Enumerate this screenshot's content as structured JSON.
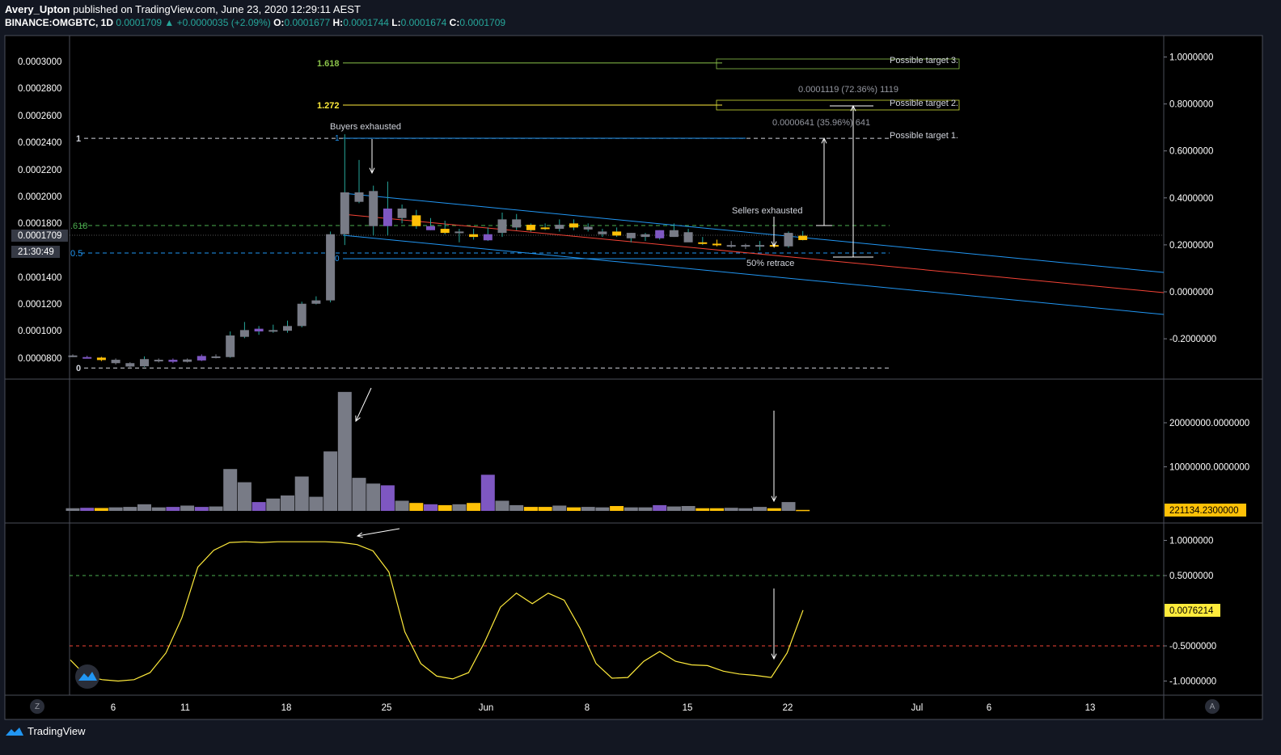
{
  "header": {
    "publisher": "Avery_Upton",
    "published_text": "published on TradingView.com, June 23, 2020 12:29:11 AEST",
    "symbol": "BINANCE:OMGBTC, 1D",
    "last": "0.0001709",
    "change_arrow": "▲",
    "change": "+0.0000035 (+2.09%)",
    "o_label": "O:",
    "o": "0.0001677",
    "h_label": "H:",
    "h": "0.0001744",
    "l_label": "L:",
    "l": "0.0001674",
    "c_label": "C:",
    "c": "0.0001709"
  },
  "price_axis_left": [
    "0.0003000",
    "0.0002800",
    "0.0002600",
    "0.0002400",
    "0.0002200",
    "0.0002000",
    "0.0001800",
    "0.0001709",
    "0.0001400",
    "0.0001200",
    "0.0001000",
    "0.0000800"
  ],
  "countdown": "21:30:49",
  "right_axis_main": [
    "1.0000000",
    "0.8000000",
    "0.6000000",
    "0.4000000",
    "0.2000000",
    "0.0000000",
    "-0.2000000"
  ],
  "right_axis_volume": [
    "20000000.0000000",
    "10000000.0000000"
  ],
  "volume_tag": "221134.2300000",
  "right_axis_osc": [
    "1.0000000",
    "0.5000000",
    "-0.5000000",
    "-1.0000000"
  ],
  "osc_tag": "0.0076214",
  "time_axis": [
    "6",
    "11",
    "18",
    "25",
    "Jun",
    "8",
    "15",
    "22",
    "Jul",
    "6",
    "13"
  ],
  "fib_labels": {
    "f1618": "1.618",
    "f1272": "1.272",
    "f1": "1",
    "f0": "0",
    "f618": ".618",
    "f05": "0.5",
    "inner1": "1",
    "inner0": "0"
  },
  "annotations": {
    "buyers": "Buyers exhausted",
    "sellers": "Sellers exhausted",
    "retrace": "50% retrace",
    "target3": "Possible target 3.",
    "target2": "Possible target 2.",
    "target1": "Possible target 1.",
    "measure1": "0.0001119 (72.36%) 1119",
    "measure2": "0.0000641 (35.96%) 641"
  },
  "corner_buttons": {
    "left": "Z",
    "right": "A"
  },
  "footer": {
    "brand": "TradingView"
  },
  "colors": {
    "background": "#131722",
    "up_candle": "#787b86",
    "down_candle": "#ffc107",
    "purple_candle": "#7e57c2",
    "channel": "#2196f3",
    "midline": "#f44336",
    "oscillator": "#ffeb3b",
    "fib_1618": "#8bc34a",
    "fib_1272": "#ffeb3b"
  },
  "chart_data": {
    "type": "candlestick",
    "symbol": "BINANCE:OMGBTC",
    "interval": "1D",
    "candles": [
      {
        "o": 8.22e-05,
        "h": 8.3e-05,
        "l": 8.1e-05,
        "c": 8.18e-05
      },
      {
        "o": 8.1e-05,
        "h": 8.2e-05,
        "l": 8e-05,
        "c": 8.05e-05
      },
      {
        "o": 8.06e-05,
        "h": 8.12e-05,
        "l": 7.8e-05,
        "c": 7.88e-05
      },
      {
        "o": 7.9e-05,
        "h": 8e-05,
        "l": 7.55e-05,
        "c": 7.65e-05
      },
      {
        "o": 7.65e-05,
        "h": 7.72e-05,
        "l": 7.35e-05,
        "c": 7.4e-05
      },
      {
        "o": 7.42e-05,
        "h": 8.15e-05,
        "l": 7.38e-05,
        "c": 7.95e-05
      },
      {
        "o": 7.85e-05,
        "h": 8e-05,
        "l": 7.7e-05,
        "c": 7.9e-05
      },
      {
        "o": 7.9e-05,
        "h": 8e-05,
        "l": 7.65e-05,
        "c": 7.75e-05
      },
      {
        "o": 7.75e-05,
        "h": 8e-05,
        "l": 7.7e-05,
        "c": 7.92e-05
      },
      {
        "o": 7.85e-05,
        "h": 8.3e-05,
        "l": 7.8e-05,
        "c": 8.18e-05
      },
      {
        "o": 8.08e-05,
        "h": 8.3e-05,
        "l": 8e-05,
        "c": 8.15e-05
      },
      {
        "o": 8.1e-05,
        "h": 0.0001,
        "l": 8.05e-05,
        "c": 9.7e-05
      },
      {
        "o": 9.6e-05,
        "h": 0.000107,
        "l": 9.5e-05,
        "c": 0.000101
      },
      {
        "o": 0.0001,
        "h": 0.000104,
        "l": 9.75e-05,
        "c": 0.000102
      },
      {
        "o": 0.000101,
        "h": 0.000105,
        "l": 9.9e-05,
        "c": 0.0001
      },
      {
        "o": 0.0001005,
        "h": 0.000108,
        "l": 9.9e-05,
        "c": 0.000104
      },
      {
        "o": 0.000104,
        "h": 0.000122,
        "l": 0.000103,
        "c": 0.0001205
      },
      {
        "o": 0.0001205,
        "h": 0.000126,
        "l": 0.00012,
        "c": 0.000123
      },
      {
        "o": 0.000123,
        "h": 0.000174,
        "l": 0.0001215,
        "c": 0.000172
      },
      {
        "o": 0.000172,
        "h": 0.000246,
        "l": 0.000164,
        "c": 0.000203
      },
      {
        "o": 0.000203,
        "h": 0.000227,
        "l": 0.000195,
        "c": 0.000196
      },
      {
        "o": 0.000204,
        "h": 0.000208,
        "l": 0.000171,
        "c": 0.000178
      },
      {
        "o": 0.000178,
        "h": 0.000211,
        "l": 0.000171,
        "c": 0.000191
      },
      {
        "o": 0.000191,
        "h": 0.000194,
        "l": 0.00018,
        "c": 0.000184
      },
      {
        "o": 0.000186,
        "h": 0.00019,
        "l": 0.000176,
        "c": 0.000178
      },
      {
        "o": 0.000178,
        "h": 0.000184,
        "l": 0.000175,
        "c": 0.000175
      },
      {
        "o": 0.000176,
        "h": 0.000182,
        "l": 0.000172,
        "c": 0.000173
      },
      {
        "o": 0.000173,
        "h": 0.000176,
        "l": 0.000166,
        "c": 0.000174
      },
      {
        "o": 0.000172,
        "h": 0.000176,
        "l": 0.000168,
        "c": 0.00017
      },
      {
        "o": 0.000172,
        "h": 0.000177,
        "l": 0.000167,
        "c": 0.0001675
      },
      {
        "o": 0.000173,
        "h": 0.000188,
        "l": 0.00017,
        "c": 0.000183
      },
      {
        "o": 0.000177,
        "h": 0.000187,
        "l": 0.000175,
        "c": 0.000183
      },
      {
        "o": 0.000179,
        "h": 0.00018,
        "l": 0.000174,
        "c": 0.000175
      },
      {
        "o": 0.000177,
        "h": 0.00018,
        "l": 0.000175,
        "c": 0.000176
      },
      {
        "o": 0.000176,
        "h": 0.000183,
        "l": 0.000174,
        "c": 0.000179
      },
      {
        "o": 0.000177,
        "h": 0.000183,
        "l": 0.000175,
        "c": 0.00018
      },
      {
        "o": 0.0001775,
        "h": 0.00018,
        "l": 0.000174,
        "c": 0.0001755
      },
      {
        "o": 0.000174,
        "h": 0.000176,
        "l": 0.00017,
        "c": 0.000172
      },
      {
        "o": 0.000174,
        "h": 0.000177,
        "l": 0.00017,
        "c": 0.000171
      },
      {
        "o": 0.000169,
        "h": 0.000173,
        "l": 0.000166,
        "c": 0.000173
      },
      {
        "o": 0.000172,
        "h": 0.000173,
        "l": 0.000167,
        "c": 0.00017
      },
      {
        "o": 0.000169,
        "h": 0.000175,
        "l": 0.000168,
        "c": 0.000175
      },
      {
        "o": 0.000175,
        "h": 0.00018,
        "l": 0.00017,
        "c": 0.00017
      },
      {
        "o": 0.0001735,
        "h": 0.000176,
        "l": 0.000168,
        "c": 0.000166
      },
      {
        "o": 0.000166,
        "h": 0.00017,
        "l": 0.000164,
        "c": 0.000165
      },
      {
        "o": 0.000165,
        "h": 0.000168,
        "l": 0.000163,
        "c": 0.000164
      },
      {
        "o": 0.000164,
        "h": 0.000167,
        "l": 0.000162,
        "c": 0.000163
      },
      {
        "o": 0.000163,
        "h": 0.000165,
        "l": 0.000161,
        "c": 0.000164
      },
      {
        "o": 0.000164,
        "h": 0.000167,
        "l": 0.00016,
        "c": 0.000164
      },
      {
        "o": 0.000163,
        "h": 0.000165,
        "l": 0.000162,
        "c": 0.000164
      },
      {
        "o": 0.000163,
        "h": 0.000174,
        "l": 0.000162,
        "c": 0.000173
      },
      {
        "o": 0.0001677,
        "h": 0.0001744,
        "l": 0.0001674,
        "c": 0.0001709
      }
    ],
    "candle_colors": [
      "gray",
      "purple",
      "gold",
      "gray",
      "gray",
      "gray",
      "gray",
      "purple",
      "gray",
      "purple",
      "gray",
      "gray",
      "gray",
      "purple",
      "gray",
      "gray",
      "gray",
      "gray",
      "gray",
      "gray",
      "gray",
      "gray",
      "purple",
      "gray",
      "gold",
      "purple",
      "gold",
      "gray",
      "gold",
      "purple",
      "gray",
      "gray",
      "gold",
      "gold",
      "gray",
      "gold",
      "gray",
      "gray",
      "gold",
      "gray",
      "gray",
      "purple",
      "gray",
      "gray",
      "gold",
      "gold",
      "gray",
      "gray",
      "gray",
      "gold",
      "gray",
      "gold"
    ],
    "volume": [
      600000,
      700000,
      650000,
      800000,
      900000,
      1500000,
      800000,
      900000,
      1200000,
      900000,
      1000000,
      9500000,
      6500000,
      2000000,
      2800000,
      3500000,
      7800000,
      3200000,
      13500000,
      27000000,
      7500000,
      6200000,
      5800000,
      2300000,
      1800000,
      1500000,
      1300000,
      1500000,
      1800000,
      8200000,
      2300000,
      1300000,
      900000,
      900000,
      1200000,
      800000,
      900000,
      800000,
      1100000,
      800000,
      800000,
      1300000,
      1000000,
      1100000,
      600000,
      600000,
      700000,
      600000,
      900000,
      600000,
      2000000,
      221134
    ],
    "oscillator": [
      -0.7,
      -0.93,
      -0.98,
      -1.0,
      -0.98,
      -0.88,
      -0.6,
      -0.1,
      0.62,
      0.86,
      0.97,
      0.98,
      0.97,
      0.98,
      0.98,
      0.98,
      0.98,
      0.97,
      0.94,
      0.85,
      0.55,
      -0.3,
      -0.75,
      -0.93,
      -0.97,
      -0.88,
      -0.45,
      0.05,
      0.25,
      0.1,
      0.25,
      0.15,
      -0.25,
      -0.75,
      -0.96,
      -0.95,
      -0.72,
      -0.58,
      -0.72,
      -0.77,
      -0.78,
      -0.86,
      -0.9,
      -0.92,
      -0.95,
      -0.6,
      0.0076
    ],
    "fib_levels": [
      {
        "ratio": "1.618",
        "price": 0.00029888
      },
      {
        "ratio": "1.272",
        "price": 0.00026763
      },
      {
        "ratio": "1",
        "price": 0.00024307
      },
      {
        "ratio": "0",
        "price": 7.293e-05
      }
    ],
    "oscillator_levels": [
      0.5,
      -0.5
    ],
    "price_range": [
      7.3e-05,
      0.000301
    ],
    "right_axis_range": [
      -0.2,
      1.0
    ],
    "volume_range": [
      0,
      27000000
    ],
    "oscillator_range": [
      -1.0,
      1.0
    ]
  }
}
